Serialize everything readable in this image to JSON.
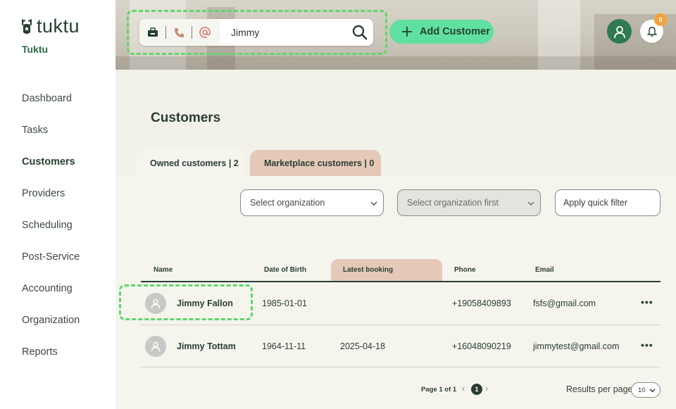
{
  "app": {
    "brand": "tuktu",
    "organization": "Tuktu"
  },
  "sidebar": {
    "items": [
      {
        "label": "Dashboard",
        "active": false
      },
      {
        "label": "Tasks",
        "active": false
      },
      {
        "label": "Customers",
        "active": true
      },
      {
        "label": "Providers",
        "active": false
      },
      {
        "label": "Scheduling",
        "active": false
      },
      {
        "label": "Post-Service",
        "active": false
      },
      {
        "label": "Accounting",
        "active": false
      },
      {
        "label": "Organization",
        "active": false
      },
      {
        "label": "Reports",
        "active": false
      }
    ]
  },
  "header": {
    "search": {
      "value": "Jimmy",
      "modes": [
        "id-card-icon",
        "phone-icon",
        "at-sign-icon"
      ]
    },
    "add_customer_label": "Add Customer",
    "notification_count": "0"
  },
  "main": {
    "title": "Customers",
    "tabs": [
      {
        "label": "Owned customers | 2",
        "active": true
      },
      {
        "label": "Marketplace customers | 0",
        "active": false
      }
    ],
    "filters": {
      "organization_placeholder": "Select organization",
      "organization_second_placeholder": "Select organization first",
      "quick_filter_label": "Apply quick filter"
    },
    "table": {
      "columns": [
        "Name",
        "Date of Birth",
        "Latest booking",
        "Phone",
        "Email"
      ],
      "rows": [
        {
          "name": "Jimmy Fallon",
          "dob": "1985-01-01",
          "latest_booking": "",
          "phone": "+19058409893",
          "email": "fsfs@gmail.com"
        },
        {
          "name": "Jimmy Tottam",
          "dob": "1964-11-11",
          "latest_booking": "2025-04-18",
          "phone": "+16048090219",
          "email": "jimmytest@gmail.com"
        }
      ],
      "row_menu": "•••"
    },
    "pagination": {
      "page_info": "Page 1 of 1",
      "current_page": "1",
      "results_per_page_label": "Results per page",
      "results_per_page_value": "10"
    }
  },
  "colors": {
    "accent": "#5fe0a0",
    "brand_dark": "#25402f",
    "highlight_tab": "#e5c9b8",
    "annotation": "#5ed86a",
    "badge": "#f3a33a"
  }
}
